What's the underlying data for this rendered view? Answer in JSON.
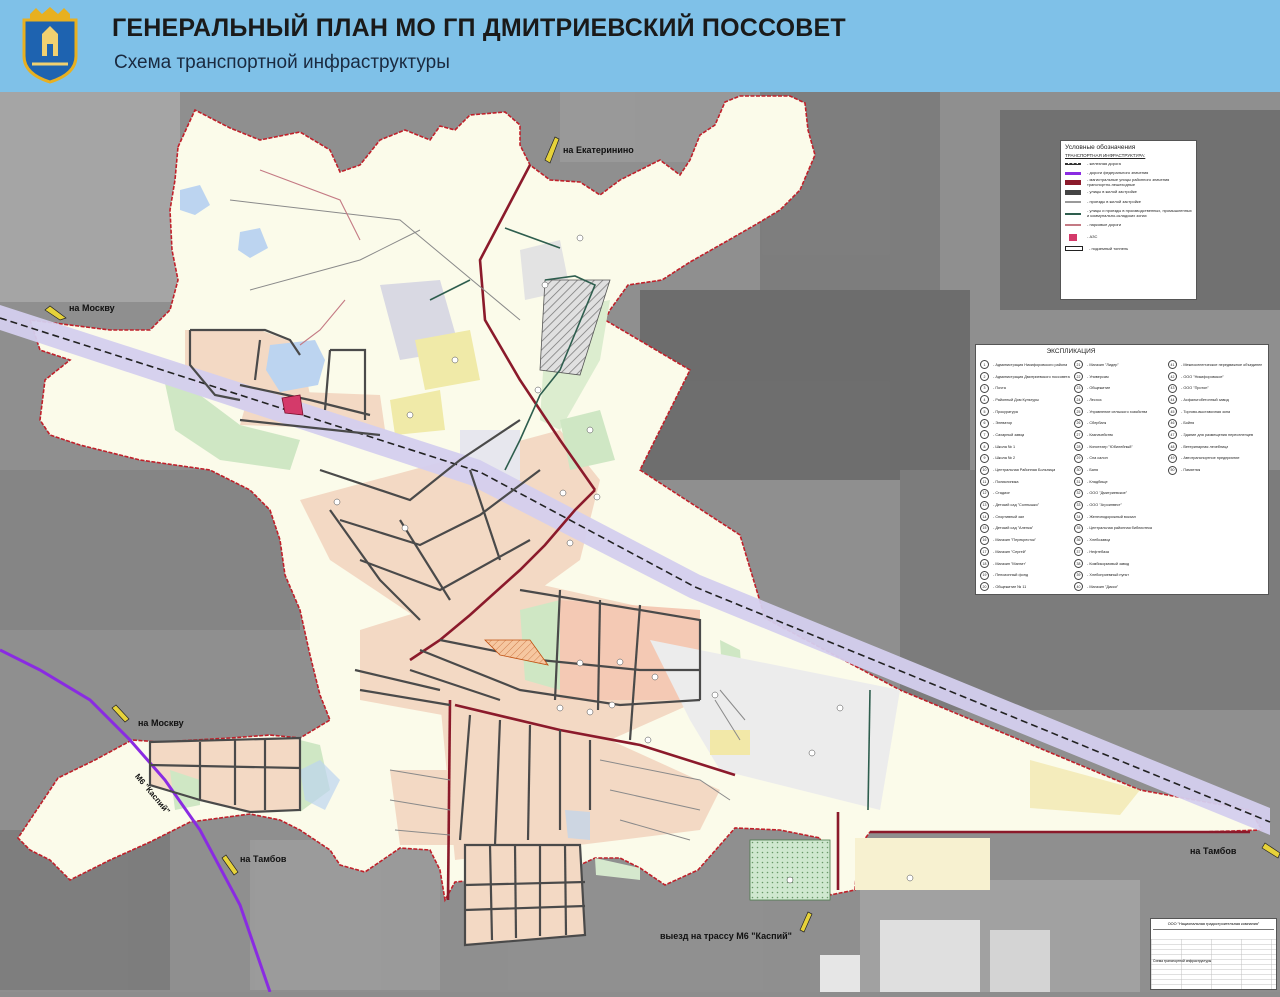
{
  "header": {
    "title": "ГЕНЕРАЛЬНЫЙ ПЛАН МО ГП ДМИТРИЕВСКИЙ ПОССОВЕТ",
    "subtitle": "Схема транспортной инфраструктуры"
  },
  "directions": {
    "ekaterinino": "на Екатеринино",
    "moscow_north": "на Москву",
    "moscow_south": "на Москву",
    "kaspiy": "М6 \"Каспий\"",
    "tambov_west": "на Тамбов",
    "tambov_east": "на Тамбов",
    "exit_m6": "выезд на трассу М6 \"Каспий\""
  },
  "legend": {
    "title": "Условные обозначения",
    "section": "ТРАНСПОРТНАЯ ИНФРАСТРУКТУРА:",
    "items": [
      {
        "label": "- железная дорога",
        "color": "#333333"
      },
      {
        "label": "- дороги федерального значения",
        "color": "#8a2be2"
      },
      {
        "label": "- магистральные улицы районного значения транспортно-пешеходные",
        "color": "#8b1a2b"
      },
      {
        "label": "- улицы в жилой застройке",
        "color": "#444444"
      },
      {
        "label": "- проезды в жилой застройке",
        "color": "#9a9a9a"
      },
      {
        "label": "- улицы и проезды в производственных, промышленных и коммунально-складских зонах",
        "color": "#2e5e4e"
      },
      {
        "label": "- парковые дороги",
        "color": "#c47a84"
      },
      {
        "label": "- АЗС",
        "color": "#d43a6a"
      },
      {
        "label": "- подземный тоннель",
        "color": "#222222"
      }
    ]
  },
  "explication": {
    "title": "ЭКСПЛИКАЦИЯ",
    "col1": [
      {
        "n": "1",
        "name": "- Администрация Никифоровского района"
      },
      {
        "n": "2",
        "name": "- Администрация Дмитриевского поссовета"
      },
      {
        "n": "3",
        "name": "- Почта"
      },
      {
        "n": "4",
        "name": "- Районный Дом Культуры"
      },
      {
        "n": "5",
        "name": "- Прокуратура"
      },
      {
        "n": "6",
        "name": "- Элеватор"
      },
      {
        "n": "7",
        "name": "- Сахарный завод"
      },
      {
        "n": "8",
        "name": "- Школа № 1"
      },
      {
        "n": "9",
        "name": "- Школа № 2"
      },
      {
        "n": "10",
        "name": "- Центральная Районная Больница"
      },
      {
        "n": "11",
        "name": "- Поликлиника"
      },
      {
        "n": "12",
        "name": "- Стадион"
      },
      {
        "n": "13",
        "name": "- Детский сад \"Солнышко\""
      },
      {
        "n": "14",
        "name": "- Спортивный зал"
      },
      {
        "n": "15",
        "name": "- Детский сад \"Аленка\""
      },
      {
        "n": "16",
        "name": "- Магазин \"Перекресток\""
      },
      {
        "n": "17",
        "name": "- Магазин \"Сергей\""
      },
      {
        "n": "18",
        "name": "- Магазин \"Магнит\""
      },
      {
        "n": "19",
        "name": "- Пенсионный фонд"
      },
      {
        "n": "20",
        "name": "- Общежитие № 11"
      }
    ],
    "col2": [
      {
        "n": "21",
        "name": "- Магазин \"Лидер\""
      },
      {
        "n": "22",
        "name": "- Универсам"
      },
      {
        "n": "23",
        "name": "- Общежитие"
      },
      {
        "n": "24",
        "name": "- Лесхоз"
      },
      {
        "n": "25",
        "name": "- Управление сельского хозяйства"
      },
      {
        "n": "26",
        "name": "- Сбербанк"
      },
      {
        "n": "27",
        "name": "- Казначейство"
      },
      {
        "n": "28",
        "name": "- Кинотеатр \"Юбилейный\""
      },
      {
        "n": "29",
        "name": "- Спа салон"
      },
      {
        "n": "30",
        "name": "- Баня"
      },
      {
        "n": "31",
        "name": "- Кладбище"
      },
      {
        "n": "32",
        "name": "- ООО \"Дмитриевское\""
      },
      {
        "n": "33",
        "name": "- ООО \"Агроинвест\""
      },
      {
        "n": "34",
        "name": "- Железнодорожный вокзал"
      },
      {
        "n": "35",
        "name": "- Центральная районная библиотека"
      },
      {
        "n": "36",
        "name": "- Хлебозавод"
      },
      {
        "n": "37",
        "name": "- Нефтебаза"
      },
      {
        "n": "38",
        "name": "- Комбикормовый завод"
      },
      {
        "n": "39",
        "name": "- Хлебоприемный пункт"
      },
      {
        "n": "40",
        "name": "- Магазин \"Дикси\""
      }
    ],
    "col3": [
      {
        "n": "41",
        "name": "- Межпоселенческое передвижное объединение"
      },
      {
        "n": "42",
        "name": "- ООО \"Никифоровское\""
      },
      {
        "n": "43",
        "name": "- ООО \"Протон\""
      },
      {
        "n": "44",
        "name": "- Асфальтобетонный завод"
      },
      {
        "n": "45",
        "name": "- Торгово-выставочная зона"
      },
      {
        "n": "46",
        "name": "- Бойня"
      },
      {
        "n": "47",
        "name": "- Здание для размещения переселенцев"
      },
      {
        "n": "48",
        "name": "- Ветеринарная лечебница"
      },
      {
        "n": "49",
        "name": "- Автотранспортное предприятие"
      },
      {
        "n": "50",
        "name": "- Памятник"
      }
    ]
  },
  "stamp": {
    "org": "ООО \"Национальная градостроительная компания\"",
    "note": "Схема транспортной инфраструктуры"
  },
  "colors": {
    "boundary": "#c0202a",
    "federal_road": "#8a2be2",
    "main_street": "#8b1a2b",
    "street": "#4a4a4a",
    "residential": "#f3d9c4",
    "territory": "#fbfbea",
    "railway_band": "#d4cfee",
    "header_bg": "#7fc1e8"
  }
}
